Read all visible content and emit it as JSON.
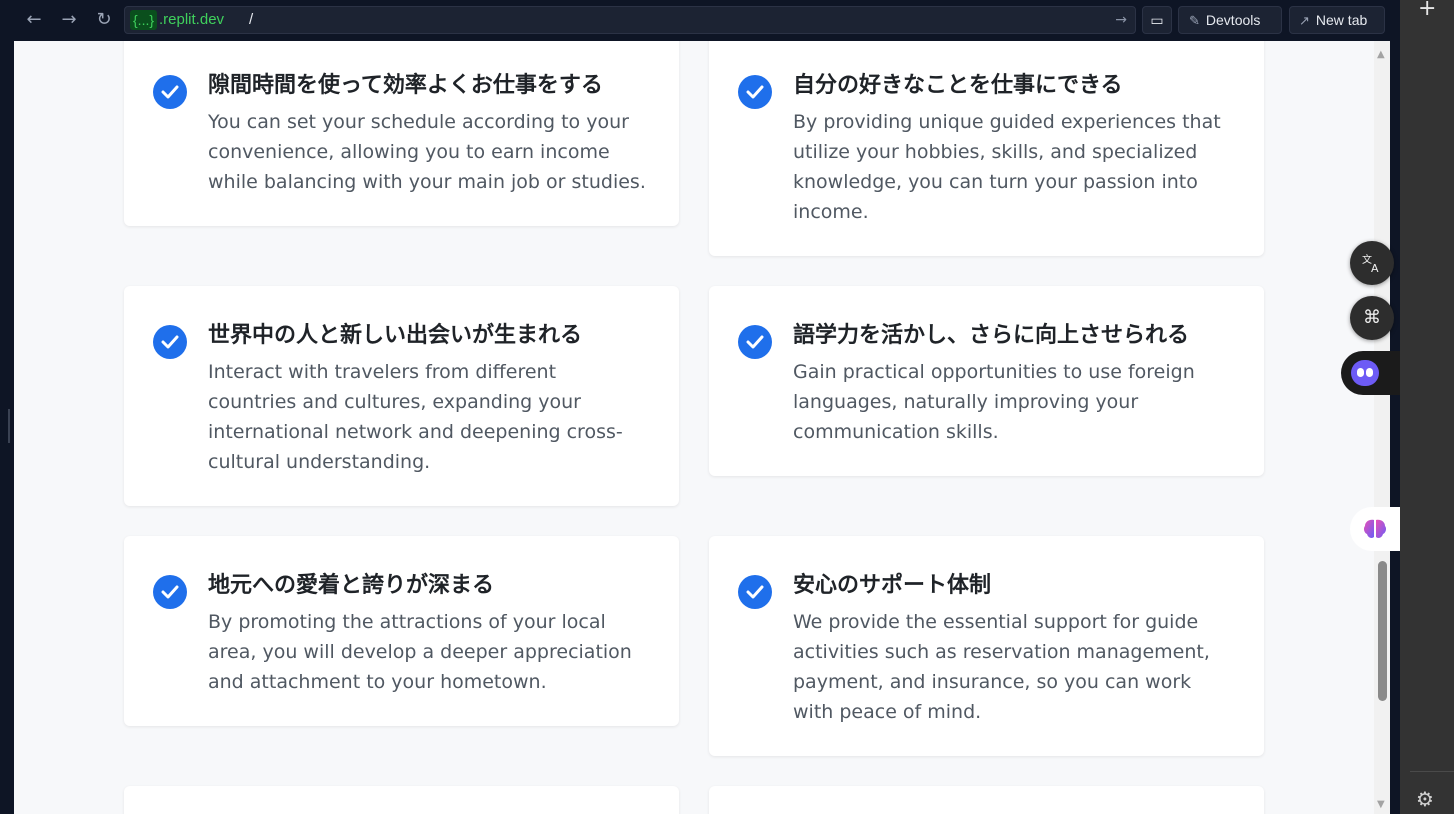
{
  "browser": {
    "url_tag": "{...}",
    "url_domain": ".replit.dev",
    "url_path": "/",
    "devtools_label": "Devtools",
    "newtab_label": "New tab"
  },
  "colors": {
    "accent": "#1f6feb",
    "card_bg": "#ffffff",
    "page_bg": "#f7f8fa"
  },
  "cards": [
    {
      "title": "隙間時間を使って効率よくお仕事をする",
      "desc": "You can set your schedule according to your convenience, allowing you to earn income while balancing with your main job or studies."
    },
    {
      "title": "自分の好きなことを仕事にできる",
      "desc": "By providing unique guided experiences that utilize your hobbies, skills, and specialized knowledge, you can turn your passion into income."
    },
    {
      "title": "世界中の人と新しい出会いが生まれる",
      "desc": "Interact with travelers from different countries and cultures, expanding your international network and deepening cross-cultural understanding."
    },
    {
      "title": "語学力を活かし、さらに向上させられる",
      "desc": "Gain practical opportunities to use foreign languages, naturally improving your communication skills."
    },
    {
      "title": "地元への愛着と誇りが深まる",
      "desc": "By promoting the attractions of your local area, you will develop a deeper appreciation and attachment to your hometown."
    },
    {
      "title": "安心のサポート体制",
      "desc": "We provide the essential support for guide activities such as reservation management, payment, and insurance, so you can work with peace of mind."
    }
  ],
  "side_panel": {
    "icons": [
      "translate-icon",
      "apps-icon",
      "assistant-icon",
      "brain-icon",
      "plus-icon",
      "settings-icon"
    ]
  }
}
